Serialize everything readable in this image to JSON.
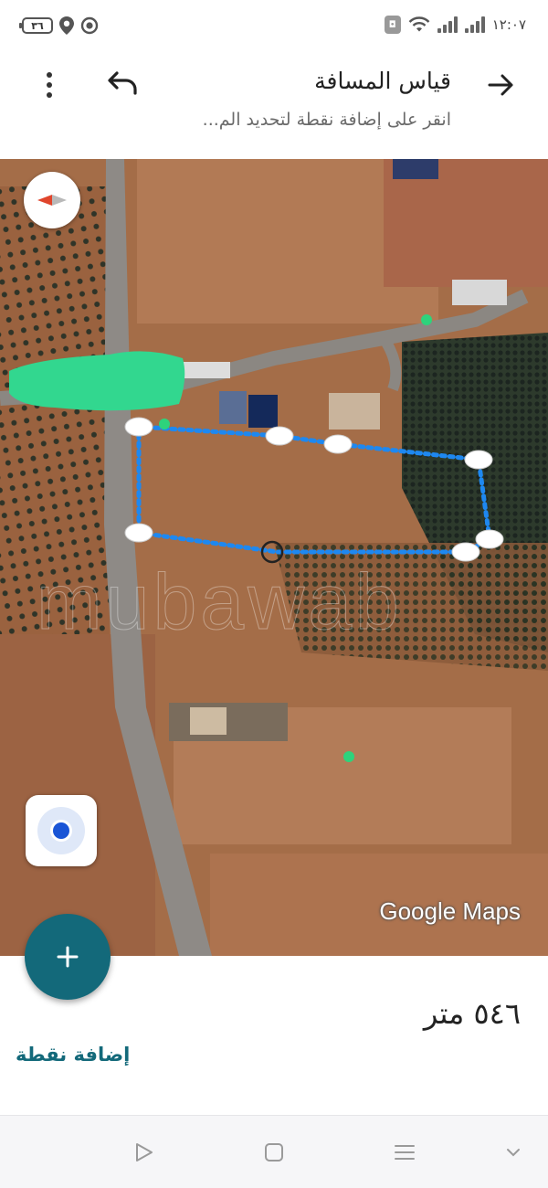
{
  "status_bar": {
    "battery": "٣٦",
    "time": "١٢:٠٧",
    "sim_label": "◘"
  },
  "header": {
    "title": "قياس المسافة",
    "subtitle": "انقر على إضافة نقطة لتحديد الم..."
  },
  "map": {
    "logo": "Google Maps",
    "watermark": "mubawab",
    "measure_color": "#1e88f0",
    "vertex_color": "#ffffff",
    "marker_color": "#2ed37c"
  },
  "fab": {
    "icon": "plus-icon",
    "color": "#13697a"
  },
  "bottom_panel": {
    "distance": "٥٤٦ متر",
    "add_point_label": "إضافة نقطة"
  },
  "navbar": {
    "icons": [
      "back-triangle-icon",
      "home-square-icon",
      "recents-menu-icon",
      "chevron-down-icon"
    ]
  }
}
